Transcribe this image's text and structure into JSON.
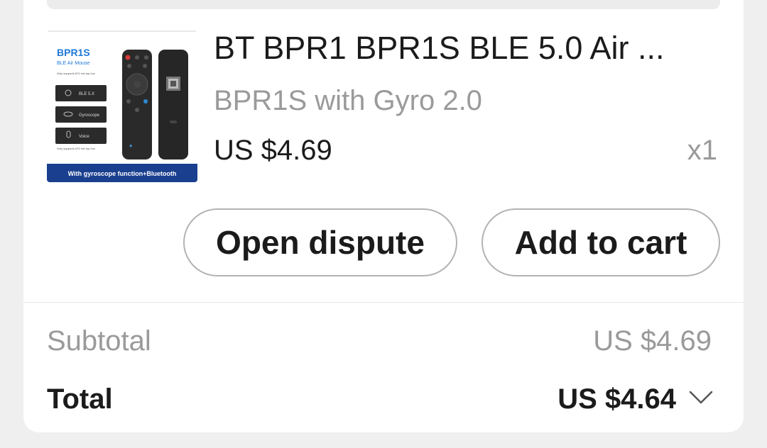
{
  "product": {
    "title": "BT BPR1 BPR1S BLE 5.0 Air ...",
    "variant": "BPR1S with Gyro 2.0",
    "price": "US $4.69",
    "quantity": "x1",
    "image": {
      "heading": "BPR1S",
      "subheading": "BLE Air Mouse",
      "note": "Only supports ATV set-top box",
      "features": [
        "BLE 5.X",
        "Gyroscope",
        "Voice"
      ],
      "footnote": "Only supports ATV set-top box",
      "banner": "With gyroscope function+Bluetooth"
    }
  },
  "actions": {
    "open_dispute": "Open dispute",
    "add_to_cart": "Add to cart"
  },
  "summary": {
    "subtotal_label": "Subtotal",
    "subtotal_value": "US $4.69",
    "total_label": "Total",
    "total_value": "US $4.64"
  }
}
